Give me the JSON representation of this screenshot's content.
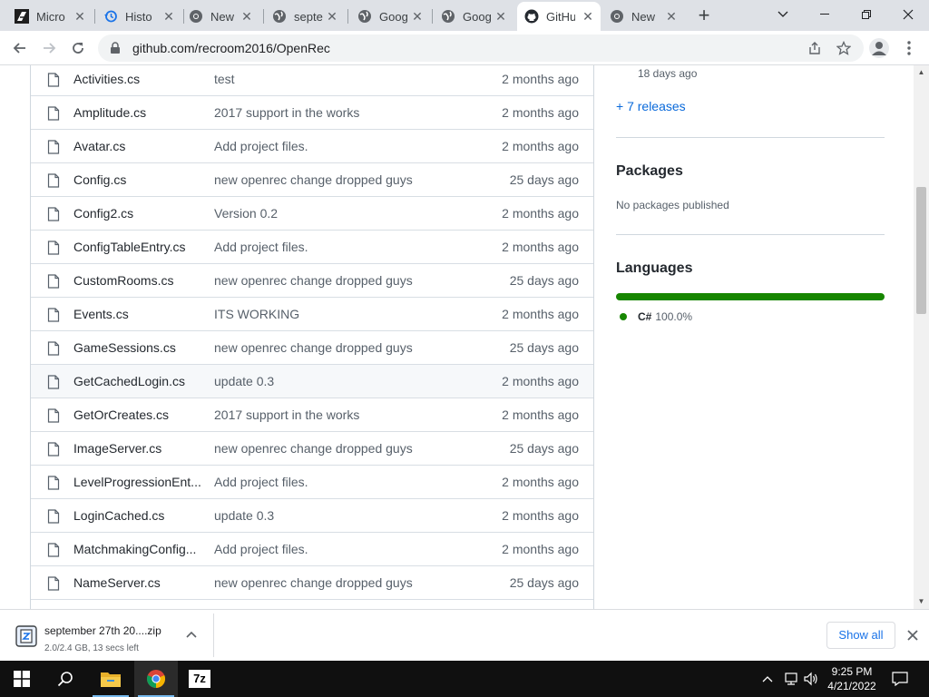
{
  "browser": {
    "tabs": [
      {
        "label": "Micro",
        "icon": "edge-dev-icon",
        "active": false
      },
      {
        "label": "Histo",
        "icon": "history-icon",
        "active": false
      },
      {
        "label": "New",
        "icon": "chrome-icon",
        "active": false
      },
      {
        "label": "septe",
        "icon": "globe-icon",
        "active": false
      },
      {
        "label": "Goog",
        "icon": "globe-icon",
        "active": false
      },
      {
        "label": "Goog",
        "icon": "globe-icon",
        "active": false
      },
      {
        "label": "GitHu",
        "icon": "github-icon",
        "active": true
      },
      {
        "label": "New",
        "icon": "chrome-icon",
        "active": false
      }
    ],
    "url": "github.com/recroom2016/OpenRec"
  },
  "files": [
    {
      "name": "Activities.cs",
      "message": "test",
      "age": "2 months ago"
    },
    {
      "name": "Amplitude.cs",
      "message": "2017 support in the works",
      "age": "2 months ago"
    },
    {
      "name": "Avatar.cs",
      "message": "Add project files.",
      "age": "2 months ago"
    },
    {
      "name": "Config.cs",
      "message": "new openrec change dropped guys",
      "age": "25 days ago"
    },
    {
      "name": "Config2.cs",
      "message": "Version 0.2",
      "age": "2 months ago"
    },
    {
      "name": "ConfigTableEntry.cs",
      "message": "Add project files.",
      "age": "2 months ago"
    },
    {
      "name": "CustomRooms.cs",
      "message": "new openrec change dropped guys",
      "age": "25 days ago"
    },
    {
      "name": "Events.cs",
      "message": "ITS WORKING",
      "age": "2 months ago"
    },
    {
      "name": "GameSessions.cs",
      "message": "new openrec change dropped guys",
      "age": "25 days ago"
    },
    {
      "name": "GetCachedLogin.cs",
      "message": "update 0.3",
      "age": "2 months ago"
    },
    {
      "name": "GetOrCreates.cs",
      "message": "2017 support in the works",
      "age": "2 months ago"
    },
    {
      "name": "ImageServer.cs",
      "message": "new openrec change dropped guys",
      "age": "25 days ago"
    },
    {
      "name": "LevelProgressionEnt...",
      "message": "Add project files.",
      "age": "2 months ago"
    },
    {
      "name": "LoginCached.cs",
      "message": "update 0.3",
      "age": "2 months ago"
    },
    {
      "name": "MatchmakingConfig...",
      "message": "Add project files.",
      "age": "2 months ago"
    },
    {
      "name": "NameServer.cs",
      "message": "new openrec change dropped guys",
      "age": "25 days ago"
    },
    {
      "name": "",
      "message": "",
      "age": ""
    }
  ],
  "sidebar": {
    "release_age": "18 days ago",
    "more_releases": "+ 7 releases",
    "packages_title": "Packages",
    "packages_text": "No packages published",
    "languages_title": "Languages",
    "language": {
      "name": "C#",
      "percent": "100.0%",
      "color": "#178600",
      "fraction": 1.0
    }
  },
  "download": {
    "filename": "september 27th 20....zip",
    "status": "2.0/2.4 GB, 13 secs left",
    "show_all": "Show all"
  },
  "taskbar": {
    "time": "9:25 PM",
    "date": "4/21/2022",
    "apps": [
      "start-icon",
      "search-icon",
      "file-explorer-icon",
      "chrome-icon",
      "7zip-icon"
    ],
    "zip_label": "7z"
  }
}
